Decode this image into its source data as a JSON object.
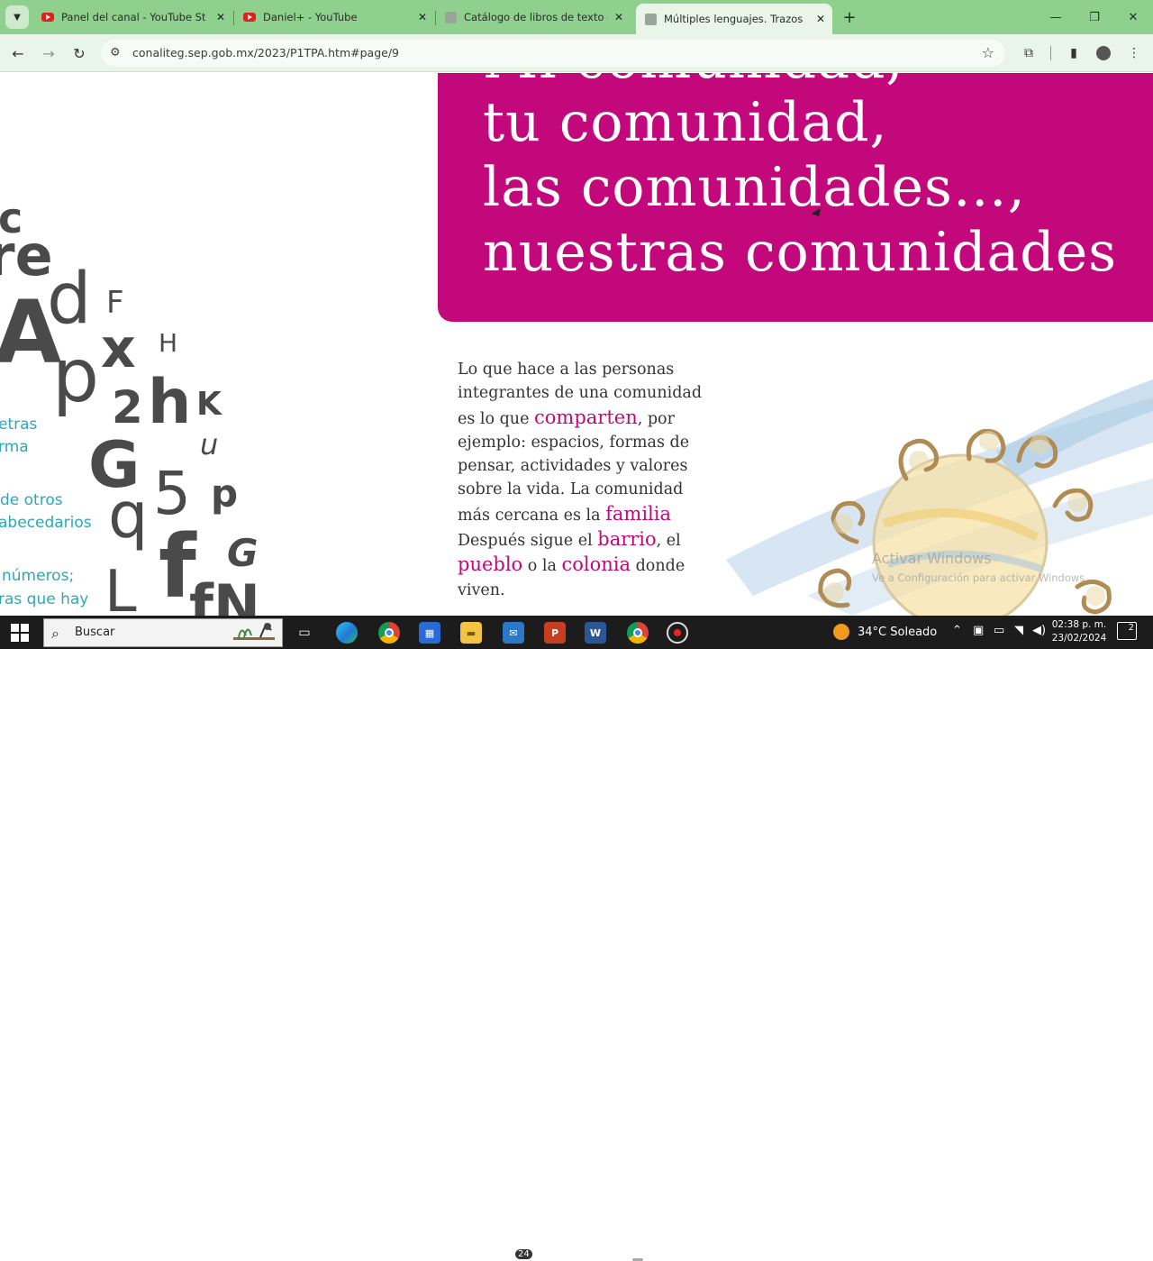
{
  "browser": {
    "tabs": [
      {
        "title": "Panel del canal - YouTube Studio",
        "favicon": "youtube-icon"
      },
      {
        "title": "Daniel+ - YouTube",
        "favicon": "youtube-icon"
      },
      {
        "title": "Catálogo de libros de texto gratuitos",
        "favicon": "sep-icon"
      },
      {
        "title": "Múltiples lenguajes. Trazos y palabras",
        "favicon": "sep-icon",
        "active": true
      }
    ],
    "url": "conaliteg.sep.gob.mx/2023/P1TPA.htm#page/9"
  },
  "page": {
    "title_lines": [
      "Mi comunidad,",
      "tu comunidad,",
      "las comunidades…,",
      "nuestras comunidades"
    ],
    "body": {
      "p1": "Lo que hace a las personas integrantes de una comunidad es lo que",
      "h1": "comparten",
      "p2": ", por ejemplo: espacios, formas de pensar, actividades y valores sobre la vida. La comunidad más cercana es la",
      "h2": "familia",
      "p3": "Después sigue el",
      "h3": "barrio",
      "p4": ", el",
      "h4": "pueblo",
      "p5": "o la",
      "h5": "colonia",
      "p6": "donde viven."
    },
    "side_text": [
      "etras",
      "rma",
      "de otros",
      "abecedarios",
      "números;",
      "ras que hay"
    ],
    "letters": [
      "c",
      "re",
      "d",
      "F",
      "A",
      "x",
      "H",
      "p",
      "2",
      "h",
      "K",
      "u",
      "G",
      "5",
      "p",
      "q",
      "f",
      "G",
      "L",
      "fN"
    ],
    "watermark": [
      "Activar Windows",
      "Ve a Configuración para activar Windows."
    ],
    "colors": {
      "accent": "#c2087a",
      "teal": "#2ba9b7",
      "tabstrip": "#8fd08f"
    }
  },
  "taskbar": {
    "search_label": "Buscar",
    "mail_badge": "24",
    "weather": "34°C  Soleado",
    "time": "02:38 p. m.",
    "date": "23/02/2024",
    "notifications": "2"
  }
}
